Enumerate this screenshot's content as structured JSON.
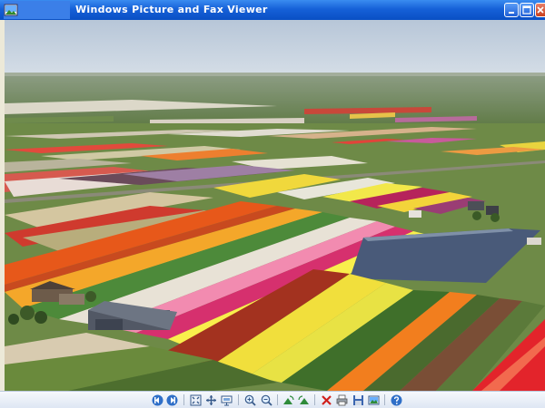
{
  "window": {
    "title": "Windows Picture and Fax Viewer"
  },
  "title_buttons": [
    "minimize-icon",
    "maximize-icon",
    "close-icon"
  ],
  "toolbar": {
    "buttons": [
      "previous-image-icon",
      "next-image-icon",
      "best-fit-icon",
      "actual-size-icon",
      "start-slideshow-icon",
      "zoom-in-icon",
      "zoom-out-icon",
      "rotate-clockwise-icon",
      "rotate-counterclockwise-icon",
      "delete-icon",
      "print-icon",
      "save-icon",
      "open-for-editing-icon",
      "help-icon"
    ]
  },
  "colors": {
    "titlebar": "#0a4fc4",
    "toolbar": "#dde6f3",
    "sky": "#c9d6e3",
    "pond": "#4a5a78"
  }
}
